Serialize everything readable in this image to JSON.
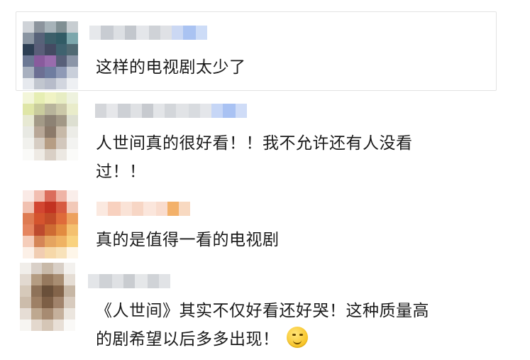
{
  "comments": [
    {
      "text": "这样的电视剧太少了"
    },
    {
      "text_line1": "人世间真的很好看！！我不允许还有人没看",
      "text_line2": "过！！"
    },
    {
      "text": "真的是值得一看的电视剧"
    },
    {
      "text_line1": "《人世间》其实不仅好看还好哭！这种质量高",
      "text_line2": "的剧希望以后多多出现！",
      "emoji": "thinking-face-icon"
    }
  ]
}
